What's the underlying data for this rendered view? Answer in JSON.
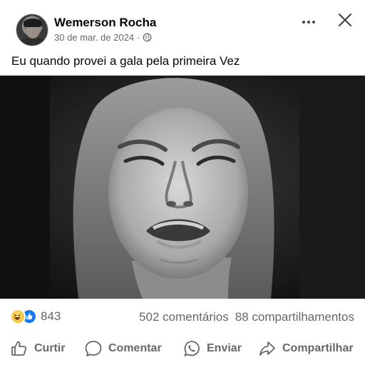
{
  "post": {
    "author": "Wemerson Rocha",
    "date": "30 de mar. de 2024",
    "separator": "·",
    "privacy_icon": "globe-icon",
    "text": "Eu quando provei a gala pela primeira Vez",
    "image_alt_icon": "photo-crying-woman"
  },
  "header_controls": {
    "more_icon": "more-horizontal-icon",
    "close_icon": "close-icon"
  },
  "stats": {
    "reactions": [
      "haha",
      "like"
    ],
    "reaction_count": "843",
    "comments": "502 comentários",
    "shares": "88 compartilhamentos"
  },
  "actions": {
    "like": "Curtir",
    "comment": "Comentar",
    "send": "Enviar",
    "share": "Compartilhar"
  },
  "colors": {
    "secondary_text": "#65676b",
    "primary_text": "#050505",
    "like_blue": "#1877f2",
    "haha_yellow": "#f7b125"
  }
}
